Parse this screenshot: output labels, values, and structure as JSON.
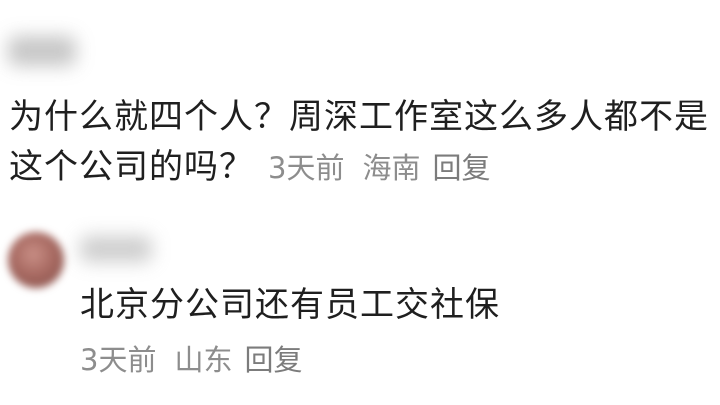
{
  "comments": [
    {
      "text": "为什么就四个人？周深工作室这么多人都不是这个公司的吗？",
      "time": "3天前",
      "location": "海南",
      "reply_label": "回复"
    },
    {
      "text": "北京分公司还有员工交社保",
      "time": "3天前",
      "location": "山东",
      "reply_label": "回复"
    }
  ]
}
